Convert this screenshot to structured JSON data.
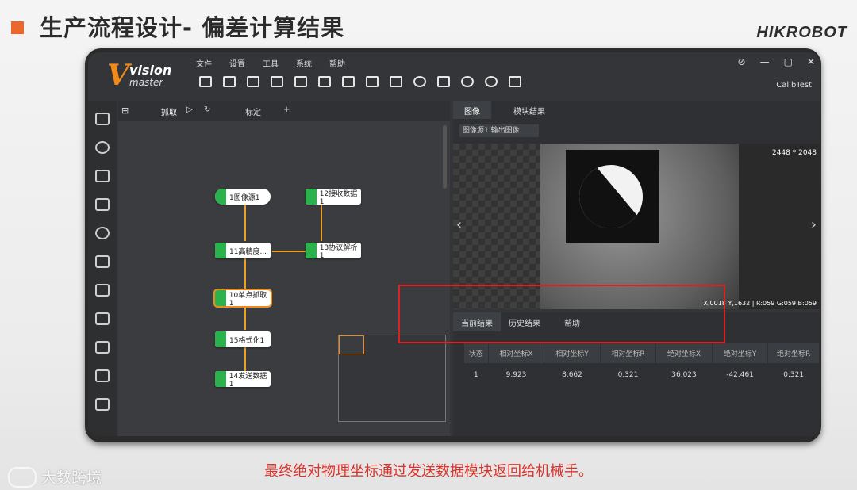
{
  "slide": {
    "title": "生产流程设计- 偏差计算结果",
    "brand": "HIKROBOT",
    "caption": "最终绝对物理坐标通过发送数据模块返回给机械手。",
    "watermark": "大数跨境"
  },
  "app": {
    "logo": {
      "v": "V",
      "vision": "vision",
      "master": "master"
    },
    "menu": [
      "文件",
      "设置",
      "工具",
      "系统",
      "帮助"
    ],
    "window_controls": [
      "⊘",
      "—",
      "▢",
      "✕"
    ],
    "calib": "CalibTest"
  },
  "flow": {
    "tabs": {
      "capture": "抓取",
      "calibrate": "标定",
      "add": "+"
    },
    "nodes": {
      "n1": "1图像源1",
      "n12": "12接收数据1",
      "n11": "11高精度...",
      "n13": "13协议解析1",
      "n10": "10单点抓取1",
      "n15": "15格式化1",
      "n14": "14发送数据1"
    }
  },
  "image_panel": {
    "tabs": {
      "image": "图像",
      "module_result": "模块结果"
    },
    "source": "图像源1.输出图像",
    "size": "2448 * 2048",
    "pixel_info": "X,0018  Y,1632 | R:059 G:059 B:059"
  },
  "results": {
    "tabs": {
      "current": "当前结果",
      "history": "历史结果",
      "help": "帮助"
    },
    "headers": [
      "状态",
      "相对坐标X",
      "相对坐标Y",
      "相对坐标R",
      "绝对坐标X",
      "绝对坐标Y",
      "绝对坐标R"
    ],
    "row": [
      "1",
      "9.923",
      "8.662",
      "0.321",
      "36.023",
      "-42.461",
      "0.321"
    ]
  }
}
